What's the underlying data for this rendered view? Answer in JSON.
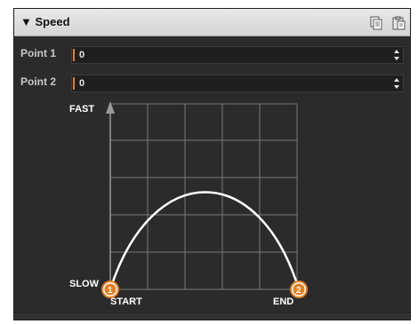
{
  "header": {
    "title": "Speed",
    "collapse_glyph": "▼"
  },
  "rows": [
    {
      "label": "Point 1",
      "value": "0"
    },
    {
      "label": "Point 2",
      "value": "0"
    }
  ],
  "graph": {
    "y_top_label": "FAST",
    "y_bottom_label": "SLOW",
    "x_left_label": "START",
    "x_right_label": "END",
    "point1_number": "1",
    "point2_number": "2"
  },
  "colors": {
    "accent": "#e67e22",
    "curve": "#ffffff",
    "grid": "#7a7a7a",
    "panel_bg": "#2b2b2b"
  }
}
